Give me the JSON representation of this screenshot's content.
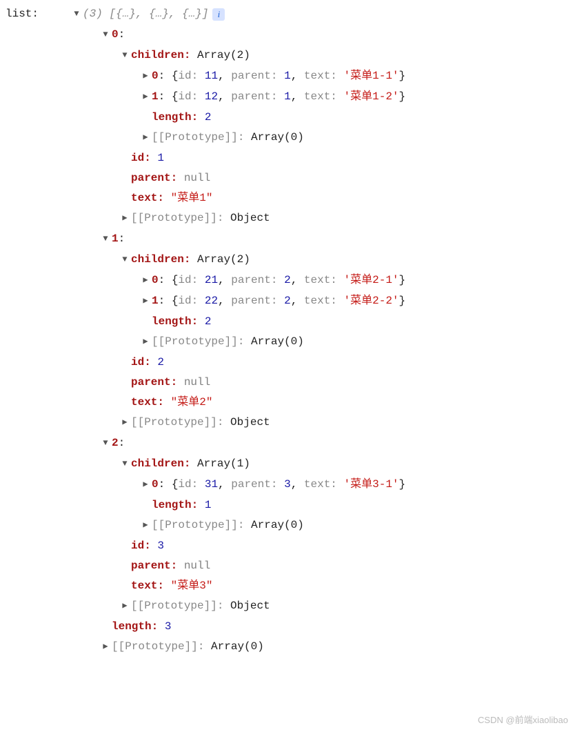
{
  "root_label": "list:",
  "preview_count": "(3)",
  "preview_body": "[{…}, {…}, {…}]",
  "info_icon": "i",
  "labels": {
    "children": "children:",
    "length": "length:",
    "prototype": "[[Prototype]]:",
    "id": "id:",
    "parent": "parent:",
    "text": "text:",
    "array0": "Array(0)",
    "object": "Object",
    "null": "null"
  },
  "items": [
    {
      "index": "0",
      "children_summary": "Array(2)",
      "children": [
        {
          "idx": "0",
          "id": "11",
          "parent": "1",
          "text": "'菜单1-1'"
        },
        {
          "idx": "1",
          "id": "12",
          "parent": "1",
          "text": "'菜单1-2'"
        }
      ],
      "children_length": "2",
      "id": "1",
      "parent": "null",
      "text": "\"菜单1\""
    },
    {
      "index": "1",
      "children_summary": "Array(2)",
      "children": [
        {
          "idx": "0",
          "id": "21",
          "parent": "2",
          "text": "'菜单2-1'"
        },
        {
          "idx": "1",
          "id": "22",
          "parent": "2",
          "text": "'菜单2-2'"
        }
      ],
      "children_length": "2",
      "id": "2",
      "parent": "null",
      "text": "\"菜单2\""
    },
    {
      "index": "2",
      "children_summary": "Array(1)",
      "children": [
        {
          "idx": "0",
          "id": "31",
          "parent": "3",
          "text": "'菜单3-1'"
        }
      ],
      "children_length": "1",
      "id": "3",
      "parent": "null",
      "text": "\"菜单3\""
    }
  ],
  "outer_length": "3",
  "child_keys": {
    "id": "id:",
    "parent": "parent:",
    "text": "text:"
  },
  "watermark": "CSDN @前端xiaolibao"
}
